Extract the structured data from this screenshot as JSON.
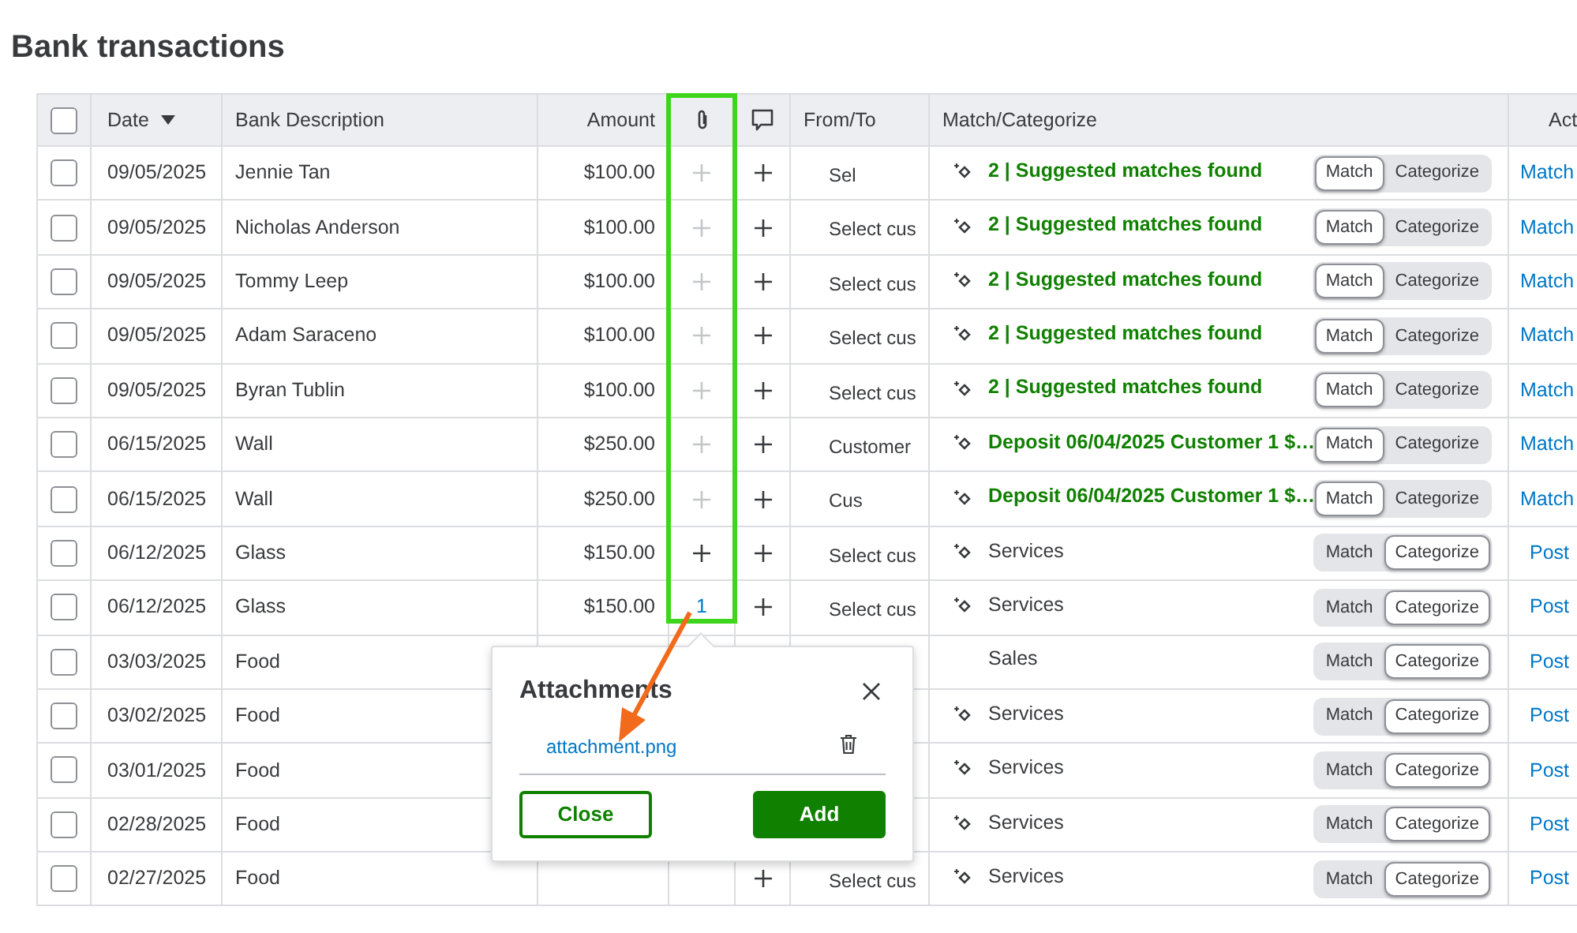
{
  "page_title": "Bank transactions",
  "table": {
    "columns": [
      {
        "kind": "select",
        "checked": false
      },
      {
        "kind": "text",
        "label": "Date",
        "sorted": true
      },
      {
        "kind": "text",
        "label": "Bank Description"
      },
      {
        "kind": "text",
        "label": "Amount"
      },
      {
        "kind": "attach"
      },
      {
        "kind": "comment"
      },
      {
        "kind": "text",
        "label": "From/To"
      },
      {
        "kind": "text",
        "label": "Match/Categorize"
      },
      {
        "kind": "text",
        "label": "Act"
      }
    ],
    "rows": [
      {
        "checked": false,
        "date": "09/05/2025",
        "description": "Jennie Tan",
        "amount": "$100.00",
        "attachment": {
          "kind": "plus",
          "disabled": true
        },
        "from_to": "Sel",
        "match": {
          "kind": "suggestion",
          "icon": true,
          "text": "2 | Suggested matches found"
        },
        "mode": [
          {
            "label": "Match",
            "selected": true
          },
          {
            "label": "Categorize",
            "selected": false
          }
        ],
        "action": "Match"
      },
      {
        "checked": false,
        "date": "09/05/2025",
        "description": "Nicholas Anderson",
        "amount": "$100.00",
        "attachment": {
          "kind": "plus",
          "disabled": true
        },
        "from_to": "Select cus",
        "match": {
          "kind": "suggestion",
          "icon": true,
          "text": "2 | Suggested matches found"
        },
        "mode": [
          {
            "label": "Match",
            "selected": true
          },
          {
            "label": "Categorize",
            "selected": false
          }
        ],
        "action": "Match"
      },
      {
        "checked": false,
        "date": "09/05/2025",
        "description": "Tommy Leep",
        "amount": "$100.00",
        "attachment": {
          "kind": "plus",
          "disabled": true
        },
        "from_to": "Select cus",
        "match": {
          "kind": "suggestion",
          "icon": true,
          "text": "2 | Suggested matches found"
        },
        "mode": [
          {
            "label": "Match",
            "selected": true
          },
          {
            "label": "Categorize",
            "selected": false
          }
        ],
        "action": "Match"
      },
      {
        "checked": false,
        "date": "09/05/2025",
        "description": "Adam Saraceno",
        "amount": "$100.00",
        "attachment": {
          "kind": "plus",
          "disabled": true
        },
        "from_to": "Select cus",
        "match": {
          "kind": "suggestion",
          "icon": true,
          "text": "2 | Suggested matches found"
        },
        "mode": [
          {
            "label": "Match",
            "selected": true
          },
          {
            "label": "Categorize",
            "selected": false
          }
        ],
        "action": "Match"
      },
      {
        "checked": false,
        "date": "09/05/2025",
        "description": "Byran Tublin",
        "amount": "$100.00",
        "attachment": {
          "kind": "plus",
          "disabled": true
        },
        "from_to": "Select cus",
        "match": {
          "kind": "suggestion",
          "icon": true,
          "text": "2 | Suggested matches found"
        },
        "mode": [
          {
            "label": "Match",
            "selected": true
          },
          {
            "label": "Categorize",
            "selected": false
          }
        ],
        "action": "Match"
      },
      {
        "checked": false,
        "date": "06/15/2025",
        "description": "Wall",
        "amount": "$250.00",
        "attachment": {
          "kind": "plus",
          "disabled": true
        },
        "from_to": "Customer",
        "match": {
          "kind": "suggestion",
          "icon": true,
          "text": "Deposit 06/04/2025 Customer 1 $…"
        },
        "mode": [
          {
            "label": "Match",
            "selected": true
          },
          {
            "label": "Categorize",
            "selected": false
          }
        ],
        "action": "Match"
      },
      {
        "checked": false,
        "date": "06/15/2025",
        "description": "Wall",
        "amount": "$250.00",
        "attachment": {
          "kind": "plus",
          "disabled": true
        },
        "from_to": "Cus",
        "match": {
          "kind": "suggestion",
          "icon": true,
          "text": "Deposit 06/04/2025 Customer 1 $…"
        },
        "mode": [
          {
            "label": "Match",
            "selected": true
          },
          {
            "label": "Categorize",
            "selected": false
          }
        ],
        "action": "Match"
      },
      {
        "checked": false,
        "date": "06/12/2025",
        "description": "Glass",
        "amount": "$150.00",
        "attachment": {
          "kind": "plus",
          "disabled": false
        },
        "from_to": "Select cus",
        "match": {
          "kind": "category",
          "icon": true,
          "text": "Services"
        },
        "mode": [
          {
            "label": "Match",
            "selected": false
          },
          {
            "label": "Categorize",
            "selected": true
          }
        ],
        "action": "Post"
      },
      {
        "checked": false,
        "date": "06/12/2025",
        "description": "Glass",
        "amount": "$150.00",
        "attachment": {
          "kind": "count",
          "text": "1"
        },
        "from_to": "Select cus",
        "match": {
          "kind": "category",
          "icon": true,
          "text": "Services"
        },
        "mode": [
          {
            "label": "Match",
            "selected": false
          },
          {
            "label": "Categorize",
            "selected": true
          }
        ],
        "action": "Post"
      },
      {
        "checked": false,
        "date": "03/03/2025",
        "description": "Food",
        "match": {
          "kind": "category",
          "icon": false,
          "text": "Sales"
        },
        "mode": [
          {
            "label": "Match",
            "selected": false
          },
          {
            "label": "Categorize",
            "selected": true
          }
        ],
        "action": "Post"
      },
      {
        "checked": false,
        "date": "03/02/2025",
        "description": "Food",
        "match": {
          "kind": "category",
          "icon": true,
          "text": "Services"
        },
        "mode": [
          {
            "label": "Match",
            "selected": false
          },
          {
            "label": "Categorize",
            "selected": true
          }
        ],
        "action": "Post"
      },
      {
        "checked": false,
        "date": "03/01/2025",
        "description": "Food",
        "match": {
          "kind": "category",
          "icon": true,
          "text": "Services"
        },
        "mode": [
          {
            "label": "Match",
            "selected": false
          },
          {
            "label": "Categorize",
            "selected": true
          }
        ],
        "action": "Post"
      },
      {
        "checked": false,
        "date": "02/28/2025",
        "description": "Food",
        "match": {
          "kind": "category",
          "icon": true,
          "text": "Services"
        },
        "mode": [
          {
            "label": "Match",
            "selected": false
          },
          {
            "label": "Categorize",
            "selected": true
          }
        ],
        "action": "Post"
      },
      {
        "checked": false,
        "date": "02/27/2025",
        "description": "Food",
        "from_to": "Select cus",
        "match": {
          "kind": "category",
          "icon": true,
          "text": "Services"
        },
        "mode": [
          {
            "label": "Match",
            "selected": false
          },
          {
            "label": "Categorize",
            "selected": true
          }
        ],
        "action": "Post"
      }
    ]
  },
  "attachments_popup": {
    "title": "Attachments",
    "files": [
      "attachment.png"
    ],
    "buttons": [
      {
        "kind": "secondary",
        "label": "Close"
      },
      {
        "kind": "primary",
        "label": "Add"
      }
    ]
  }
}
